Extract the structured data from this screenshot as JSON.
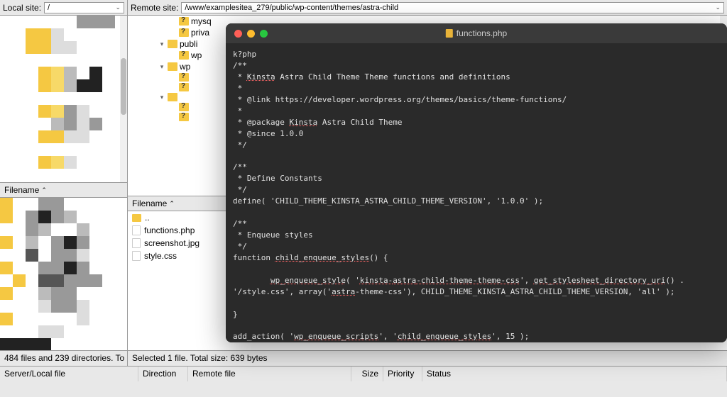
{
  "top": {
    "local_label": "Local site:",
    "local_value": "/",
    "remote_label": "Remote site:",
    "remote_value": "/www/examplesitea_279/public/wp-content/themes/astra-child"
  },
  "headers": {
    "filename": "Filename"
  },
  "remote_tree": [
    {
      "indent": 56,
      "toggle": "",
      "question": true,
      "label": "mysq"
    },
    {
      "indent": 56,
      "toggle": "",
      "question": true,
      "label": "priva"
    },
    {
      "indent": 40,
      "toggle": "▾",
      "question": false,
      "label": "publi"
    },
    {
      "indent": 56,
      "toggle": "",
      "question": true,
      "label": "wp"
    },
    {
      "indent": 40,
      "toggle": "▾",
      "question": false,
      "label": "wp"
    },
    {
      "indent": 56,
      "toggle": "",
      "question": true,
      "label": ""
    },
    {
      "indent": 56,
      "toggle": "",
      "question": true,
      "label": ""
    },
    {
      "indent": 40,
      "toggle": "▾",
      "question": false,
      "label": ""
    },
    {
      "indent": 56,
      "toggle": "",
      "question": true,
      "label": ""
    },
    {
      "indent": 56,
      "toggle": "",
      "question": true,
      "label": ""
    }
  ],
  "right_files": {
    "parent": "..",
    "items": [
      "functions.php",
      "screenshot.jpg",
      "style.css"
    ]
  },
  "status": {
    "left": "484 files and 239 directories. To",
    "right": "Selected 1 file. Total size: 639 bytes"
  },
  "bottom_cols": {
    "server": "Server/Local file",
    "direction": "Direction",
    "remote": "Remote file",
    "size": "Size",
    "priority": "Priority",
    "status": "Status"
  },
  "editor": {
    "title": "functions.php",
    "code_lines": [
      {
        "t": "k?php",
        "u": []
      },
      {
        "t": "/**",
        "u": []
      },
      {
        "t": " * Kinsta Astra Child Theme Theme functions and definitions",
        "u": [
          "Kinsta"
        ]
      },
      {
        "t": " *",
        "u": []
      },
      {
        "t": " * @link https://developer.wordpress.org/themes/basics/theme-functions/",
        "u": []
      },
      {
        "t": " *",
        "u": []
      },
      {
        "t": " * @package Kinsta Astra Child Theme",
        "u": [
          "Kinsta"
        ]
      },
      {
        "t": " * @since 1.0.0",
        "u": []
      },
      {
        "t": " */",
        "u": []
      },
      {
        "t": "",
        "u": []
      },
      {
        "t": "/**",
        "u": []
      },
      {
        "t": " * Define Constants",
        "u": []
      },
      {
        "t": " */",
        "u": []
      },
      {
        "t": "define( 'CHILD_THEME_KINSTA_ASTRA_CHILD_THEME_VERSION', '1.0.0' );",
        "u": []
      },
      {
        "t": "",
        "u": []
      },
      {
        "t": "/**",
        "u": []
      },
      {
        "t": " * Enqueue styles",
        "u": []
      },
      {
        "t": " */",
        "u": []
      },
      {
        "t": "function child_enqueue_styles() {",
        "u": [
          "child_enqueue_styles"
        ]
      },
      {
        "t": "",
        "u": []
      },
      {
        "t": "        wp_enqueue_style( 'kinsta-astra-child-theme-theme-css', get_stylesheet_directory_uri() . '/style.css', array('astra-theme-css'), CHILD_THEME_KINSTA_ASTRA_CHILD_THEME_VERSION, 'all' );",
        "u": [
          "wp_enqueue_style",
          "kinsta-astra-child-theme-theme-css",
          "get_stylesheet_directory_uri",
          "astra"
        ]
      },
      {
        "t": "",
        "u": []
      },
      {
        "t": "}",
        "u": []
      },
      {
        "t": "",
        "u": []
      },
      {
        "t": "add_action( 'wp_enqueue_scripts', 'child_enqueue_styles', 15 );",
        "u": [
          "wp_enqueue_scripts",
          "child_enqueue_styles"
        ]
      }
    ]
  }
}
